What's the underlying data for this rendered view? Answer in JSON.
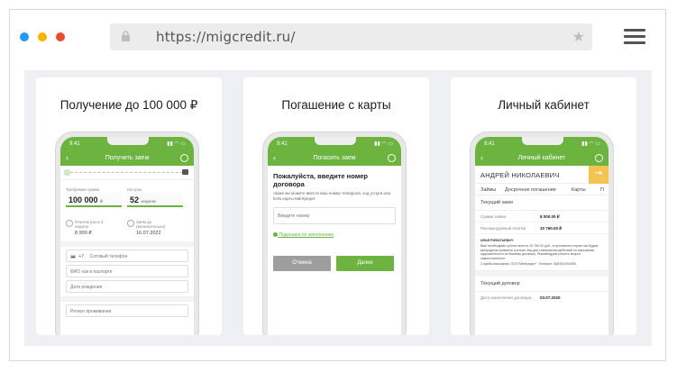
{
  "browser": {
    "url": "https://migcredit.ru/",
    "dot_colors": [
      "#1f9bf0",
      "#f5b400",
      "#ea4b2b"
    ]
  },
  "cards": [
    {
      "title": "Получение до 100 000 ₽",
      "time": "9:41",
      "appbar": "Получить заем",
      "sum_label": "Требуемая сумма",
      "sum_value": "100 000",
      "sum_unit": "₽",
      "term_label": "На срок",
      "term_value": "52",
      "term_unit": "недели",
      "pay_label": "Платеж раз в 2 недели",
      "pay_value": "8 900 ₽",
      "until_label": "Заем до (включительно)",
      "until_value": "16.07.2022",
      "phone_code": "+7",
      "phone_placeholder": "Сотовый телефон",
      "fio_placeholder": "ФИО как в паспорте",
      "dob_placeholder": "Дата рождения",
      "region_placeholder": "Регион проживания"
    },
    {
      "title": "Погашение с карты",
      "time": "9:41",
      "appbar": "Погасить заем",
      "heading": "Пожалуйста, введите номер договора",
      "sub": "также вы можете ввести ваш номер телефона, код услуги или EAN карты МигКредит",
      "input_placeholder": "Введите номер",
      "hint": "Подсказка по заполнению",
      "cancel_label": "Отмена",
      "next_label": "Далее"
    },
    {
      "title": "Личный кабинет",
      "time": "9:41",
      "appbar": "Личный кабинет",
      "user_name": "АНДРЕЙ НИКОЛАЕВИЧ",
      "tabs": [
        "Займы",
        "Досрочное погашение",
        "Карты",
        "П"
      ],
      "current_loan": "Текущий заем",
      "row1_label": "Сумма займа",
      "row1_value": "8 000.00 ₽",
      "row2_label": "Рекомендуемый платеж",
      "row2_value": "10 760.00 ₽",
      "note_name": "ИЛЬЯ РИФАТЬЕВИЧ",
      "note_text": "Вам необходимо срочно внести 10 760.00 руб., в противном случае мы будем вынуждены привлечь третьих лиц для совершения действий по взысканию задолженности по Вашему договору. Рекомендуем решить вопрос самостоятельно.",
      "note_sign": "Служба взыскания. ООО\"МигКредит\". Телефон: 8(800)1004055",
      "current_contract": "Текущий договор",
      "row3_label": "Дата заключения договора",
      "row3_value": "03.07.2020"
    }
  ]
}
